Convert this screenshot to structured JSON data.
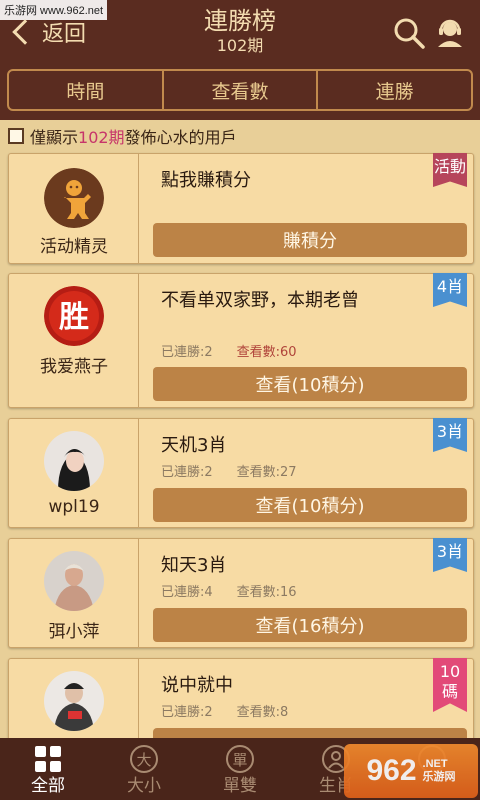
{
  "watermark": "乐游网 www.962.net",
  "header": {
    "back_label": "返回",
    "title": "連勝榜",
    "subtitle": "102期"
  },
  "tabs": [
    {
      "label": "時間"
    },
    {
      "label": "查看數"
    },
    {
      "label": "連勝"
    }
  ],
  "filter": {
    "prefix": "僅顯示",
    "highlight": "102期",
    "suffix": "發佈心水的用戶",
    "checked": false
  },
  "cards": [
    {
      "user": "活动精灵",
      "title": "點我賺積分",
      "button": "賺積分",
      "tag": "活動"
    },
    {
      "user": "我爱燕子",
      "title": "不看单双家野，本期老曾",
      "streak": "已連勝:2",
      "views": "查看數:60",
      "button": "查看(10積分)",
      "tag": "4肖"
    },
    {
      "user": "wpl19",
      "title": "天机3肖",
      "streak": "已連勝:2",
      "views": "查看數:27",
      "button": "查看(10積分)",
      "tag": "3肖"
    },
    {
      "user": "弭小萍",
      "title": "知天3肖",
      "streak": "已連勝:4",
      "views": "查看數:16",
      "button": "查看(16積分)",
      "tag": "3肖"
    },
    {
      "user": "",
      "title": "说中就中",
      "streak": "已連勝:2",
      "views": "查看數:8",
      "button": "",
      "tag": "10碼"
    }
  ],
  "bottom_nav": [
    {
      "label": "全部",
      "icon": "grid-icon",
      "active": true
    },
    {
      "label": "大小",
      "icon": "da-icon",
      "glyph": "大"
    },
    {
      "label": "單雙",
      "icon": "dan-icon",
      "glyph": "單"
    },
    {
      "label": "生肖",
      "icon": "zodiac-icon"
    },
    {
      "label": "",
      "icon": "more-icon"
    }
  ],
  "logo": {
    "big": "962",
    "small_top": ".NET",
    "small_bottom": "乐游网"
  },
  "colors": {
    "header_bg": "#5a2c20",
    "page_bg": "#e8cf98",
    "card_bg": "#f7dba4",
    "button_bg": "#bc8346",
    "tag_red": "#b6455b",
    "tag_blue": "#4a90d0",
    "tag_pink": "#e24a78",
    "highlight": "#c7356a"
  }
}
